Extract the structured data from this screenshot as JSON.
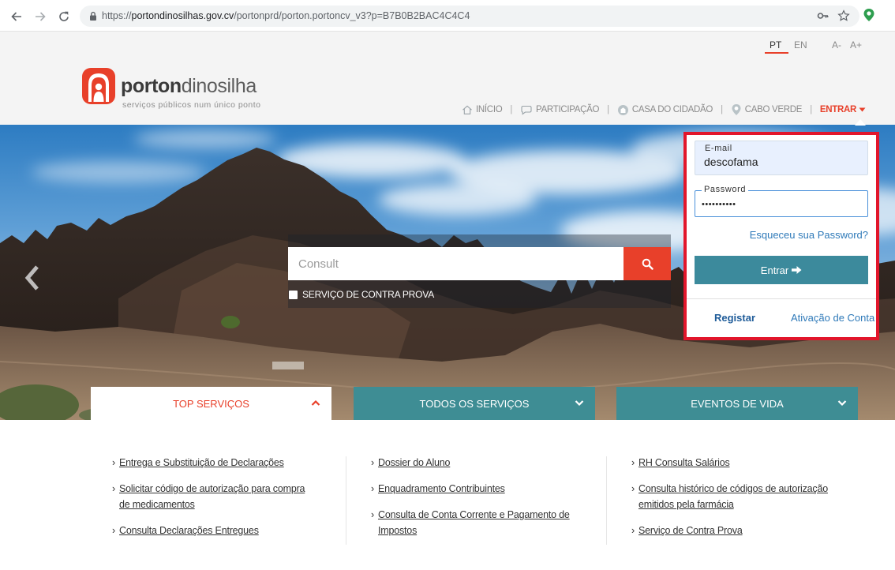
{
  "browser": {
    "url_scheme": "https://",
    "url_host": "portondinosilhas.gov.cv",
    "url_path": "/portonprd/porton.portoncv_v3?p=B7B0B2BAC4C4C4"
  },
  "topbar": {
    "languages": [
      {
        "label": "PT",
        "active": true
      },
      {
        "label": "EN",
        "active": false
      }
    ],
    "font_decrease": "A-",
    "font_increase": "A+"
  },
  "brand": {
    "name_bold": "porton",
    "name_light": "dinosilha",
    "tagline": "serviços públicos num único ponto"
  },
  "nav": {
    "separator": "|",
    "items": [
      {
        "label": "INÍCIO",
        "icon": "home-icon"
      },
      {
        "label": "PARTICIPAÇÃO",
        "icon": "chat-icon"
      },
      {
        "label": "CASA DO CIDADÃO",
        "icon": "building-icon"
      },
      {
        "label": "CABO VERDE",
        "icon": "map-pin-icon"
      }
    ],
    "login_label": "ENTRAR",
    "login_icon": "caret-down-icon"
  },
  "search": {
    "placeholder": "Consult",
    "button_icon": "search-icon",
    "checkbox_label": "SERVIÇO DE CONTRA PROVA",
    "checkbox_checked": false
  },
  "login": {
    "email_label": "E-mail",
    "email_value": "descofama",
    "password_label": "Password",
    "password_mask": "••••••••••",
    "forgot_label": "Esqueceu sua Password?",
    "submit_label": "Entrar",
    "submit_icon": "arrow-right-icon",
    "register_label": "Registar",
    "activate_label": "Ativação de Conta"
  },
  "tabs": [
    {
      "label": "TOP SERVIÇOS",
      "active": true,
      "icon": "chevron-up-icon"
    },
    {
      "label": "TODOS OS SERVIÇOS",
      "active": false,
      "icon": "chevron-down-icon"
    },
    {
      "label": "EVENTOS DE VIDA",
      "active": false,
      "icon": "chevron-down-icon"
    }
  ],
  "services": {
    "bullet": "›",
    "columns": [
      [
        {
          "lines": [
            "Entrega e Substituição de Declarações"
          ]
        },
        {
          "lines": [
            "Solicitar código de autorização para compra",
            "de medicamentos"
          ]
        },
        {
          "lines": [
            "Consulta Declarações Entregues"
          ]
        }
      ],
      [
        {
          "lines": [
            "Dossier do Aluno"
          ]
        },
        {
          "lines": [
            "Enquadramento Contribuintes"
          ]
        },
        {
          "lines": [
            "Consulta de Conta Corrente e Pagamento de",
            "Impostos"
          ]
        }
      ],
      [
        {
          "lines": [
            "RH Consulta Salários"
          ]
        },
        {
          "lines": [
            "Consulta histórico de códigos de autorização",
            "emitidos pela farmácia"
          ]
        },
        {
          "lines": [
            "Serviço de Contra Prova"
          ]
        }
      ]
    ]
  },
  "colors": {
    "accent": "#e8402a",
    "teal": "#3e8d94",
    "button": "#3c8a9c",
    "link": "#2f7ab9",
    "highlight_border": "#e2162b"
  }
}
